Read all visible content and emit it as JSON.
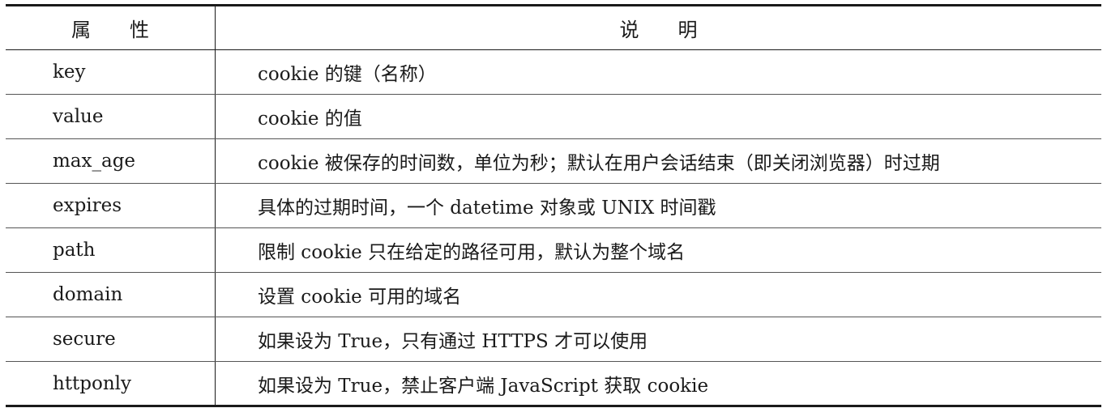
{
  "table": {
    "header": {
      "attr_char1": "属",
      "attr_char2": "性",
      "desc_char1": "说",
      "desc_char2": "明"
    },
    "rows": [
      {
        "attr": "key",
        "desc": "cookie 的键（名称）"
      },
      {
        "attr": "value",
        "desc": "cookie 的值"
      },
      {
        "attr": "max_age",
        "desc": "cookie 被保存的时间数，单位为秒；默认在用户会话结束（即关闭浏览器）时过期"
      },
      {
        "attr": "expires",
        "desc": "具体的过期时间，一个 datetime 对象或 UNIX 时间戳"
      },
      {
        "attr": "path",
        "desc": "限制 cookie 只在给定的路径可用，默认为整个域名"
      },
      {
        "attr": "domain",
        "desc": "设置 cookie 可用的域名"
      },
      {
        "attr": "secure",
        "desc": "如果设为 True，只有通过 HTTPS 才可以使用"
      },
      {
        "attr": "httponly",
        "desc": "如果设为 True，禁止客户端 JavaScript 获取 cookie"
      }
    ]
  }
}
